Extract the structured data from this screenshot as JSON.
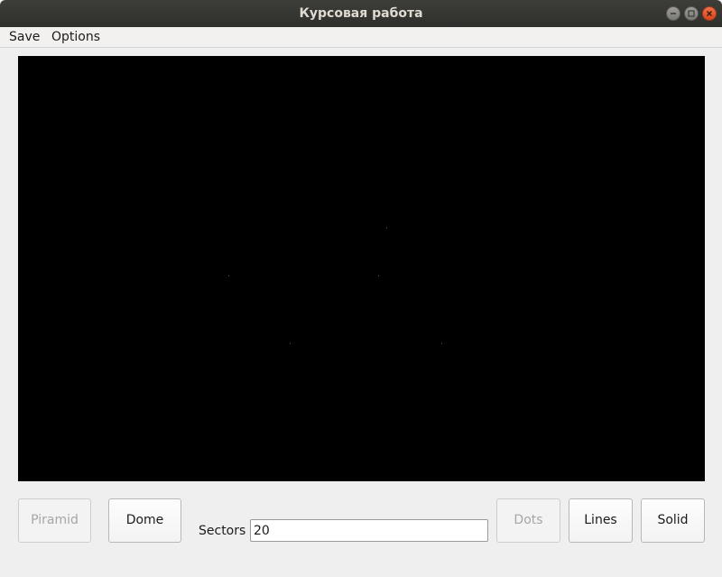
{
  "window": {
    "title": "Курсовая работа"
  },
  "window_controls": {
    "minimize_icon": "minimize-icon",
    "maximize_icon": "maximize-icon",
    "close_icon": "close-icon"
  },
  "menu": {
    "save": "Save",
    "options": "Options"
  },
  "toolbar": {
    "piramid": "Piramid",
    "dome": "Dome",
    "sectors_label": "Sectors",
    "sectors_value": "20",
    "dots": "Dots",
    "lines": "Lines",
    "solid": "Solid"
  },
  "colors": {
    "canvas_background": "#000000",
    "title_bar": "#3c3b37",
    "close_button": "#e95420"
  }
}
